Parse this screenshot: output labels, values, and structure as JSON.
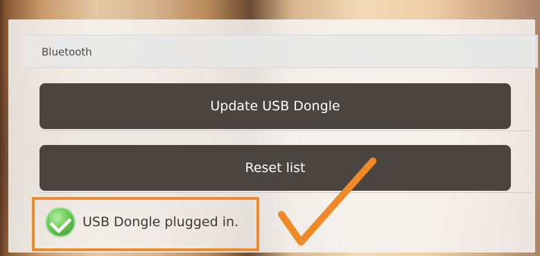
{
  "section": {
    "title": "Bluetooth"
  },
  "buttons": {
    "update_label": "Update USB Dongle",
    "reset_label": "Reset list"
  },
  "status": {
    "icon": "check-circle-icon",
    "text": "USB Dongle plugged in."
  },
  "annotation": {
    "color": "#f08a28"
  }
}
